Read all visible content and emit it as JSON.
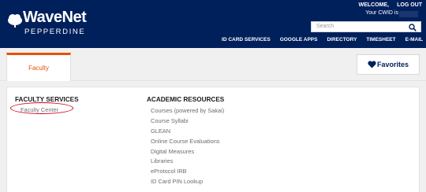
{
  "header": {
    "logo_main": "WaveNet",
    "logo_sub": "PEPPERDINE",
    "welcome": "WELCOME,",
    "logout": "LOG OUT",
    "cwid_text": "Your CWID is",
    "search_placeholder": "Search",
    "nav": [
      "ID CARD SERVICES",
      "GOOGLE APPS",
      "DIRECTORY",
      "TIMESHEET",
      "E-MAIL"
    ]
  },
  "tabs": {
    "active": "Faculty",
    "favorites": "Favorites"
  },
  "faculty_services": {
    "title": "FACULTY SERVICES",
    "items": [
      "Faculty Center"
    ]
  },
  "academic_resources": {
    "title": "ACADEMIC RESOURCES",
    "items": [
      "Courses (powered by Sakai)",
      "Course Syllabi",
      "GLEAN",
      "Online Course Evaluations",
      "Digital Measures",
      "Libraries",
      "eProtocol IRB",
      "ID Card PIN Lookup"
    ]
  },
  "colors": {
    "navy": "#00205c",
    "accent_orange": "#e35205",
    "annotation_red": "#d0021b"
  },
  "icons": [
    "cloud-icon",
    "search-icon",
    "heart-icon"
  ]
}
